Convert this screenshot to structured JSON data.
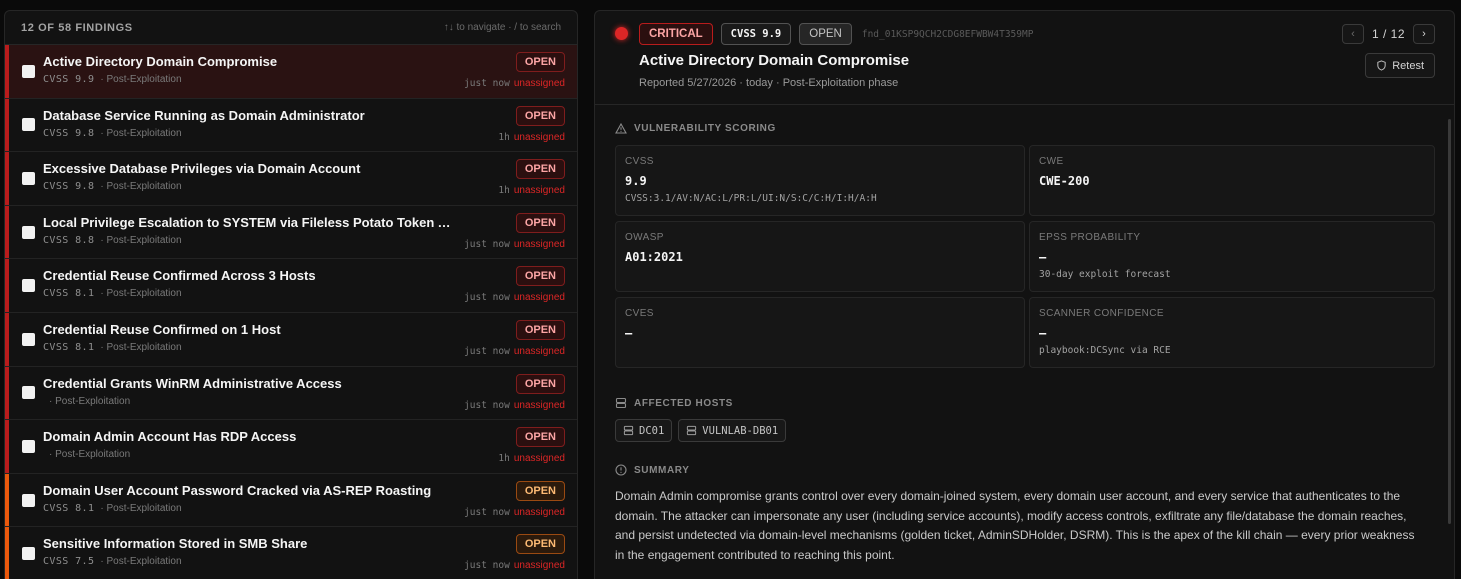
{
  "list": {
    "count_label": "12 OF 58 FINDINGS",
    "hint": "↑↓ to navigate · / to search",
    "items": [
      {
        "title": "Active Directory Domain Compromise",
        "cvss": "CVSS 9.9",
        "phase": "· Post-Exploitation",
        "status": "OPEN",
        "time": "just now",
        "assignee": "unassigned",
        "sev_color": "#b91c1c",
        "selected": true
      },
      {
        "title": "Database Service Running as Domain Administrator",
        "cvss": "CVSS 9.8",
        "phase": "· Post-Exploitation",
        "status": "OPEN",
        "time": "1h",
        "assignee": "unassigned",
        "sev_color": "#b91c1c"
      },
      {
        "title": "Excessive Database Privileges via Domain Account",
        "cvss": "CVSS 9.8",
        "phase": "· Post-Exploitation",
        "status": "OPEN",
        "time": "1h",
        "assignee": "unassigned",
        "sev_color": "#b91c1c"
      },
      {
        "title": "Local Privilege Escalation to SYSTEM via Fileless Potato Token Ab...",
        "cvss": "CVSS 8.8",
        "phase": "· Post-Exploitation",
        "status": "OPEN",
        "time": "just now",
        "assignee": "unassigned",
        "sev_color": "#b91c1c"
      },
      {
        "title": "Credential Reuse Confirmed Across 3 Hosts",
        "cvss": "CVSS 8.1",
        "phase": "· Post-Exploitation",
        "status": "OPEN",
        "time": "just now",
        "assignee": "unassigned",
        "sev_color": "#b91c1c"
      },
      {
        "title": "Credential Reuse Confirmed on 1 Host",
        "cvss": "CVSS 8.1",
        "phase": "· Post-Exploitation",
        "status": "OPEN",
        "time": "just now",
        "assignee": "unassigned",
        "sev_color": "#b91c1c"
      },
      {
        "title": "Credential Grants WinRM Administrative Access",
        "cvss": "",
        "phase": "· Post-Exploitation",
        "status": "OPEN",
        "time": "just now",
        "assignee": "unassigned",
        "sev_color": "#b91c1c"
      },
      {
        "title": "Domain Admin Account Has RDP Access",
        "cvss": "",
        "phase": "· Post-Exploitation",
        "status": "OPEN",
        "time": "1h",
        "assignee": "unassigned",
        "sev_color": "#b91c1c"
      },
      {
        "title": "Domain User Account Password Cracked via AS-REP Roasting",
        "cvss": "CVSS 8.1",
        "phase": "· Post-Exploitation",
        "status": "OPEN",
        "time": "just now",
        "assignee": "unassigned",
        "sev_color": "#ea580c",
        "orange": true
      },
      {
        "title": "Sensitive Information Stored in SMB Share",
        "cvss": "CVSS 7.5",
        "phase": "· Post-Exploitation",
        "status": "OPEN",
        "time": "just now",
        "assignee": "unassigned",
        "sev_color": "#ea580c",
        "orange": true
      }
    ]
  },
  "detail": {
    "severity": "CRITICAL",
    "cvss_badge": "CVSS 9.9",
    "status": "OPEN",
    "finding_id": "fnd_01KSP9QCH2CDG8EFWBW4T359MP",
    "title": "Active Directory Domain Compromise",
    "subtitle": "Reported 5/27/2026 · today · Post-Exploitation phase",
    "pager": {
      "position": "1 / 12",
      "prev": "‹",
      "next": "›"
    },
    "retest_label": "Retest",
    "scoring_label": "VULNERABILITY SCORING",
    "cells": {
      "cvss": {
        "label": "CVSS",
        "value": "9.9",
        "sub": "CVSS:3.1/AV:N/AC:L/PR:L/UI:N/S:C/C:H/I:H/A:H"
      },
      "cwe": {
        "label": "CWE",
        "value": "CWE-200"
      },
      "owasp": {
        "label": "OWASP",
        "value": "A01:2021"
      },
      "epss": {
        "label": "EPSS PROBABILITY",
        "value": "—",
        "sub": "30-day exploit forecast"
      },
      "cves": {
        "label": "CVES",
        "value": "—"
      },
      "confidence": {
        "label": "SCANNER CONFIDENCE",
        "value": "—",
        "sub": "playbook:DCSync via RCE"
      }
    },
    "hosts_label": "AFFECTED HOSTS",
    "hosts": [
      "DC01",
      "VULNLAB-DB01"
    ],
    "summary_label": "SUMMARY",
    "summary": "Domain Admin compromise grants control over every domain-joined system, every domain user account, and every service that authenticates to the domain. The attacker can impersonate any user (including service accounts), modify access controls, exfiltrate any file/database the domain reaches, and persist undetected via domain-level mechanisms (golden ticket, AdminSDHolder, DSRM). This is the apex of the kill chain — every prior weakness in the engagement contributed to reaching this point."
  }
}
